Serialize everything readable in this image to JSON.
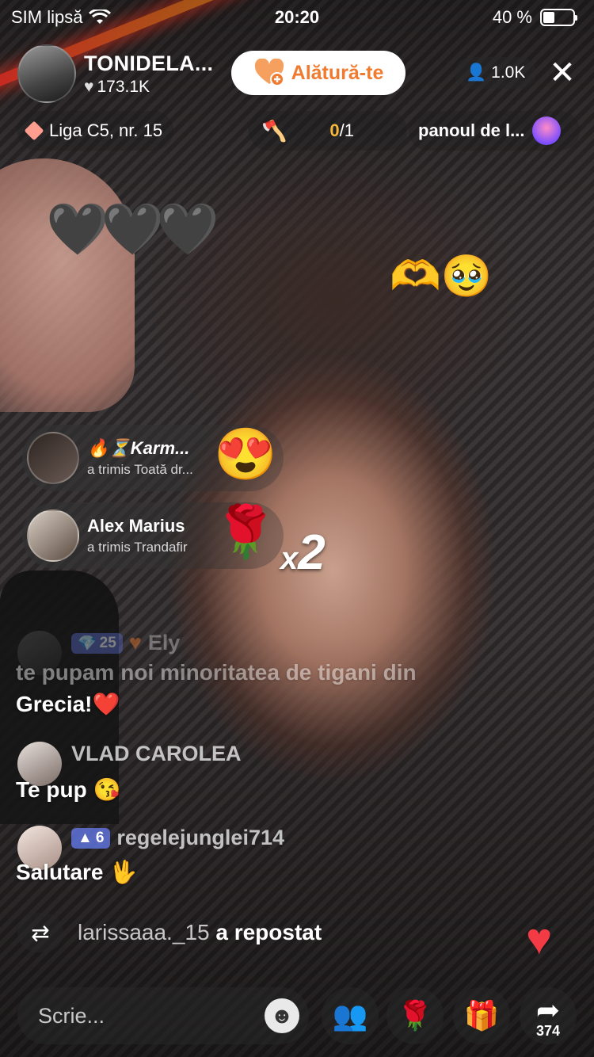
{
  "status_bar": {
    "carrier": "SIM lipsă",
    "time": "20:20",
    "battery": "40 %",
    "battery_level": 0.4
  },
  "host": {
    "name": "TONIDELA...",
    "likes": "173.1K"
  },
  "join_button": {
    "label": "Alătură-te"
  },
  "viewers": {
    "count": "1.0K"
  },
  "league": {
    "label": "Liga C5, nr. 15"
  },
  "goal": {
    "done": "0",
    "total": "/1"
  },
  "panel": {
    "label": "panoul de l..."
  },
  "floating": {
    "hearts": "🖤🖤🖤",
    "emojis": "🫶🥹"
  },
  "gifts": [
    {
      "name": "🔥⏳Karm...",
      "action": "a trimis Toată dr...",
      "icon": "😍"
    },
    {
      "name": "Alex Marius",
      "action": "a trimis Trandafir",
      "icon": "🌹",
      "combo_x": "x",
      "combo_n": "2"
    }
  ],
  "comments": [
    {
      "badge": "25",
      "user": "Ely",
      "text": "te pupam noi minoritatea de tigani din",
      "text2": "Grecia!❤️"
    },
    {
      "user": "VLAD CAROLEA",
      "text": "Te pup 😘"
    },
    {
      "badge": "6",
      "user": "regelejunglei714",
      "text": "Salutare 🖖"
    }
  ],
  "repost": {
    "user": "larissaaa._15",
    "action": "a repostat"
  },
  "bottom": {
    "placeholder": "Scrie...",
    "share_count": "374"
  },
  "colors": {
    "accent": "#f07a2e",
    "like": "#f23b45",
    "badge": "#5f73dc"
  }
}
